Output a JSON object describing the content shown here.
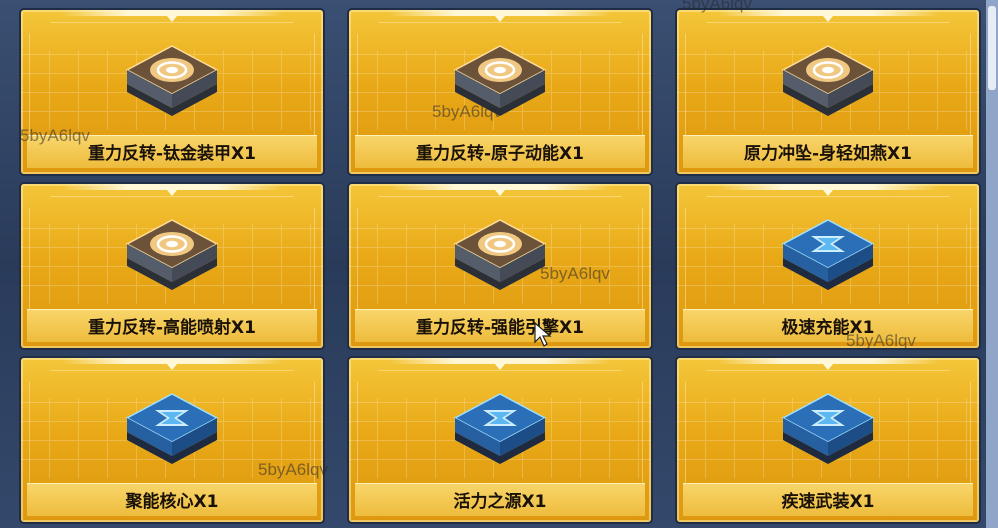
{
  "items": [
    {
      "label": "重力反转-钛金装甲X1",
      "icon": "orange-core-module-icon"
    },
    {
      "label": "重力反转-原子动能X1",
      "icon": "orange-core-module-icon"
    },
    {
      "label": "原力冲坠-身轻如燕X1",
      "icon": "orange-core-module-icon"
    },
    {
      "label": "重力反转-高能喷射X1",
      "icon": "orange-core-module-icon"
    },
    {
      "label": "重力反转-强能引擎X1",
      "icon": "orange-core-module-icon"
    },
    {
      "label": "极速充能X1",
      "icon": "blue-hourglass-module-icon"
    },
    {
      "label": "聚能核心X1",
      "icon": "blue-hourglass-module-icon"
    },
    {
      "label": "活力之源X1",
      "icon": "blue-hourglass-module-icon"
    },
    {
      "label": "疾速武装X1",
      "icon": "blue-hourglass-module-icon"
    }
  ],
  "watermarks": [
    "5byA6lqv",
    "5byA6lqv",
    "5byA6lqv",
    "5byA6lqv",
    "5byA6lqv",
    "5byA6lqv"
  ],
  "colors": {
    "card_gold": "#e9a917",
    "background": "#2c3e5c",
    "orange_glow": "#ffb347",
    "blue_glow": "#4fb3ff"
  }
}
